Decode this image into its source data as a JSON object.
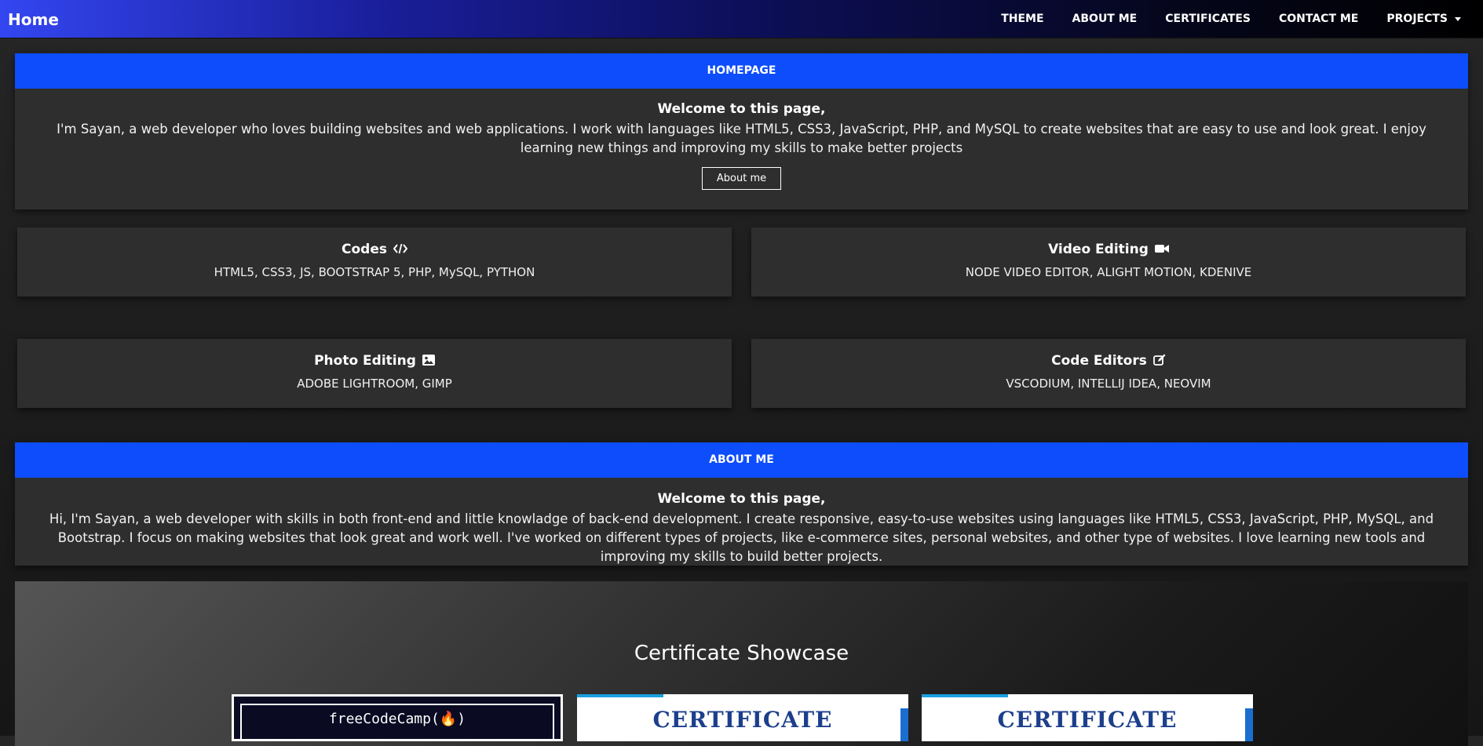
{
  "nav": {
    "brand": "Home",
    "links": [
      "THEME",
      "ABOUT ME",
      "CERTIFICATES",
      "CONTACT ME",
      "PROJECTS"
    ]
  },
  "homepage": {
    "header": "HOMEPAGE",
    "welcome": "Welcome to this page,",
    "text": "I'm Sayan, a web developer who loves building websites and web applications. I work with languages like HTML5, CSS3, JavaScript, PHP, and MySQL to create websites that are easy to use and look great. I enjoy learning new things and improving my skills to make better projects",
    "button": "About me"
  },
  "skills": [
    {
      "title": "Codes",
      "icon": "code-icon",
      "text": "HTML5, CSS3, JS, BOOTSTRAP 5, PHP, MySQL, PYTHON"
    },
    {
      "title": "Video Editing",
      "icon": "video-camera-icon",
      "text": "NODE VIDEO EDITOR, ALIGHT MOTION, KDENIVE"
    },
    {
      "title": "Photo Editing",
      "icon": "image-icon",
      "text": "ADOBE LIGHTROOM, GIMP"
    },
    {
      "title": "Code Editors",
      "icon": "edit-icon",
      "text": "VSCODIUM, INTELLIJ IDEA, NEOVIM"
    }
  ],
  "about": {
    "header": "ABOUT ME",
    "welcome": "Welcome to this page,",
    "text": "Hi, I'm Sayan, a web developer with skills in both front-end and little knowladge of back-end development. I create responsive, easy-to-use websites using languages like HTML5, CSS3, JavaScript, PHP, MySQL, and Bootstrap. I focus on making websites that look great and work well. I've worked on different types of projects, like e-commerce sites, personal websites, and other type of websites. I love learning new tools and improving my skills to build better projects."
  },
  "showcase": {
    "title": "Certificate Showcase",
    "certs": [
      "freeCodeCamp(🔥)",
      "CERTIFICATE",
      "CERTIFICATE"
    ]
  },
  "colors": {
    "accent": "#0d4dfb",
    "card": "#2e2e2e"
  }
}
